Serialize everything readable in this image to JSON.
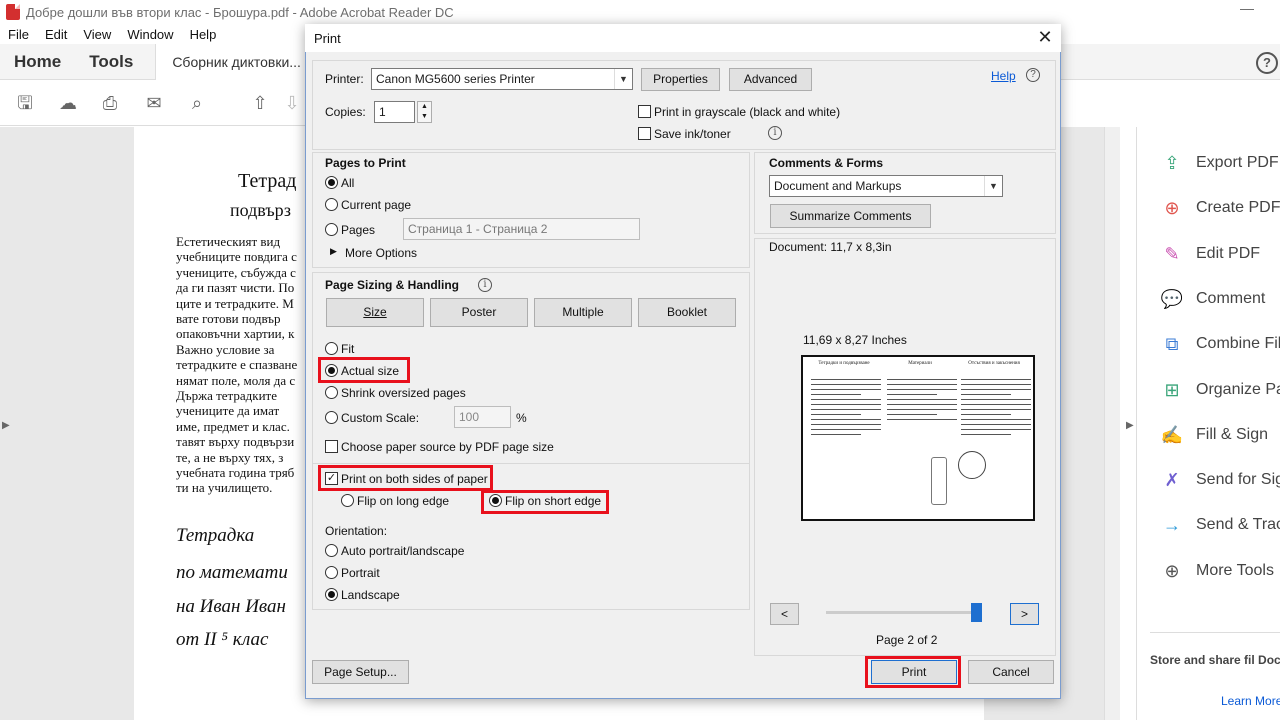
{
  "window": {
    "title": "Добре дошли във втори клас - Брошура.pdf - Adobe Acrobat Reader DC"
  },
  "menu": [
    "File",
    "Edit",
    "View",
    "Window",
    "Help"
  ],
  "nav": {
    "home": "Home",
    "tools": "Tools",
    "doc_tab": "Сборник диктовки..."
  },
  "doc": {
    "title1": "Тетрад",
    "title2": "подвърз",
    "lines": [
      "  Естетическият вид",
      "учебниците повдига с",
      "учениците, събужда с",
      "да ги пазят чисти. По",
      "ците и тетрадките. М",
      "вате готови подвър",
      "опаковъчни хартии, к",
      "  Важно условие за",
      "тетрадките е спазване",
      "нямат поле, моля да с",
      "  Държа тетрадките",
      "учениците да имат",
      "име, предмет и клас.",
      "тавят върху подвързи",
      "те, а не върху тях, з",
      "учебната година тряб",
      "ти на училището."
    ],
    "hand": [
      "Тетрадка",
      "по математи",
      "на Иван Иван",
      "от II ⁵ клас"
    ]
  },
  "tools_pane": {
    "items": [
      {
        "label": "Export PDF",
        "icon": "export-pdf-icon",
        "color": "#3aa57a"
      },
      {
        "label": "Create PDF",
        "icon": "create-pdf-icon",
        "color": "#e0564f"
      },
      {
        "label": "Edit PDF",
        "icon": "edit-pdf-icon",
        "color": "#c94fb0"
      },
      {
        "label": "Comment",
        "icon": "comment-icon",
        "color": "#f2b53a"
      },
      {
        "label": "Combine Files",
        "icon": "combine-files-icon",
        "color": "#3a7bd5"
      },
      {
        "label": "Organize Pages",
        "icon": "organize-pages-icon",
        "color": "#3aa57a"
      },
      {
        "label": "Fill & Sign",
        "icon": "fill-sign-icon",
        "color": "#7a6fd8"
      },
      {
        "label": "Send for Signature",
        "icon": "send-signature-icon",
        "color": "#6f5fd0"
      },
      {
        "label": "Send & Track",
        "icon": "send-track-icon",
        "color": "#2d9ad8"
      },
      {
        "label": "More Tools",
        "icon": "more-tools-icon",
        "color": "#555555"
      }
    ],
    "footer_text": "Store and share fil Document Cl",
    "learn_more": "Learn More"
  },
  "dialog": {
    "title": "Print",
    "printer_label": "Printer:",
    "printer_value": "Canon MG5600 series Printer",
    "properties": "Properties",
    "advanced": "Advanced",
    "help": "Help",
    "copies_label": "Copies:",
    "copies_value": "1",
    "grayscale": "Print in grayscale (black and white)",
    "save_ink": "Save ink/toner",
    "pages_to_print": {
      "heading": "Pages to Print",
      "all": "All",
      "current": "Current page",
      "pages": "Pages",
      "pages_placeholder": "Страница 1 - Страница 2",
      "more_options": "More Options"
    },
    "sizing": {
      "heading": "Page Sizing & Handling",
      "tabs": [
        "Size",
        "Poster",
        "Multiple",
        "Booklet"
      ],
      "fit": "Fit",
      "actual": "Actual size",
      "shrink": "Shrink oversized pages",
      "custom": "Custom Scale:",
      "custom_value": "100",
      "percent": "%",
      "paper_source": "Choose paper source by PDF page size",
      "both_sides": "Print on both sides of paper",
      "flip_long": "Flip on long edge",
      "flip_short": "Flip on short edge"
    },
    "orientation": {
      "heading": "Orientation:",
      "auto": "Auto portrait/landscape",
      "portrait": "Portrait",
      "landscape": "Landscape"
    },
    "comments": {
      "heading": "Comments & Forms",
      "value": "Document and Markups",
      "summarize": "Summarize Comments"
    },
    "preview": {
      "document_size": "Document: 11,7 x 8,3in",
      "page_size": "11,69 x 8,27 Inches",
      "page_indicator": "Page 2 of 2",
      "page_current": 2,
      "page_total": 2,
      "thumb_headings": [
        "Тетрадки и подвързване",
        "Материали",
        "Отсъствия и закъснения"
      ]
    },
    "page_setup": "Page Setup...",
    "print": "Print",
    "cancel": "Cancel"
  },
  "colors": {
    "highlight": "#e8101c",
    "accent": "#1e6fd0"
  }
}
